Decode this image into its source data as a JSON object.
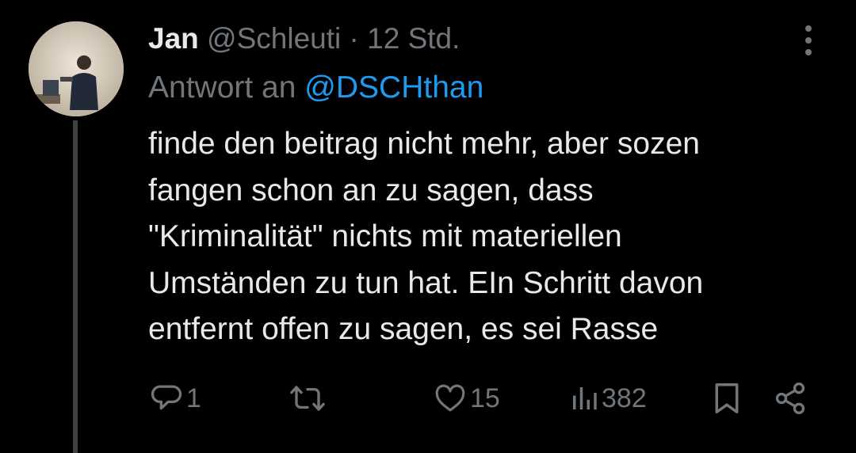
{
  "tweet": {
    "author_name": "Jan",
    "handle": "@Schleuti",
    "separator": "·",
    "time": "12 Std.",
    "reply_prefix": "Antwort an",
    "reply_mention": "@DSCHthan",
    "lines": [
      "finde den beitrag nicht mehr, aber sozen",
      "fangen schon an zu sagen, dass",
      "\"Kriminalität\" nichts mit materiellen",
      "Umständen zu tun hat. EIn Schritt davon",
      "entfernt offen zu sagen, es sei Rasse"
    ]
  },
  "actions": {
    "replies": "1",
    "retweets": "",
    "likes": "15",
    "views": "382"
  },
  "colors": {
    "background": "#000000",
    "text": "#e7e9ea",
    "muted": "#71767b",
    "accent": "#1d9bf0",
    "thread_line": "#3e4144"
  },
  "icons": [
    "more-vertical-icon",
    "reply-icon",
    "retweet-icon",
    "like-icon",
    "views-icon",
    "bookmark-icon",
    "share-icon"
  ]
}
